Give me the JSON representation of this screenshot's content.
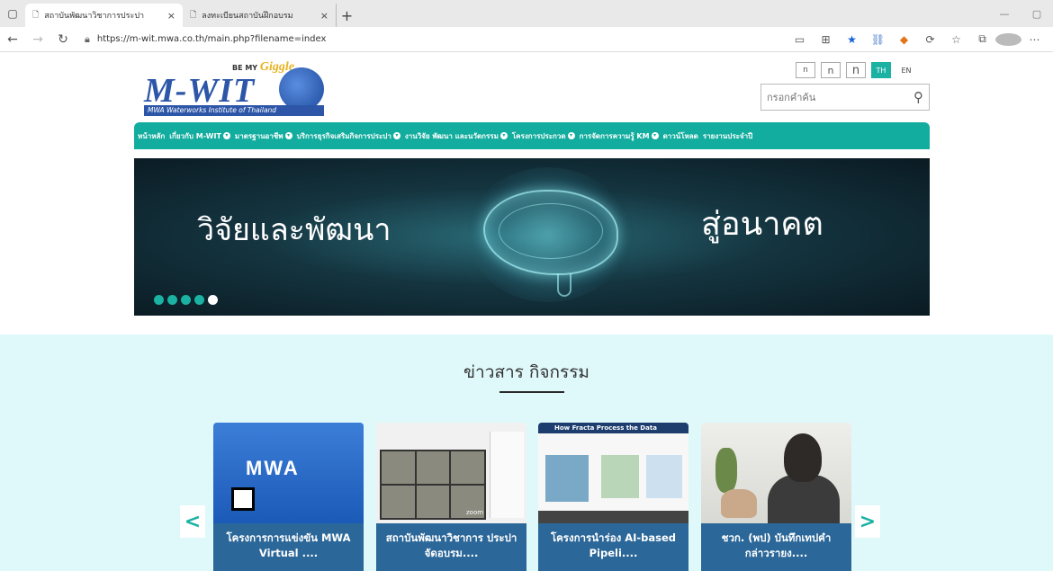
{
  "browser": {
    "tabs": [
      {
        "title": "สถาบันพัฒนาวิชาการประปา"
      },
      {
        "title": "ลงทะเบียนสถาบันฝึกอบรม"
      }
    ],
    "tab_close": "×",
    "new_tab": "+",
    "url": "https://m-wit.mwa.co.th/main.php?filename=index",
    "icons": [
      "back-icon",
      "forward-icon",
      "refresh-icon",
      "lock-icon",
      "reading-view-icon",
      "qr-icon",
      "favorite-star-icon",
      "link-icon",
      "metamask-fox-icon",
      "extension-icon",
      "favorites-icon",
      "collections-icon",
      "profile-icon",
      "more-icon"
    ]
  },
  "header": {
    "logo_tag_prefix": "BE MY",
    "logo_tag_brand": "Giggle",
    "logo_main": "M-WIT",
    "logo_sub": "MWA Waterworks Institute of Thailand",
    "font_size_small": "n",
    "font_size_medium": "n",
    "font_size_large": "n",
    "lang_th": "TH",
    "lang_en": "EN",
    "search_placeholder": "กรอกคำค้น",
    "colors": {
      "accent": "#12ad9e",
      "brand_blue": "#2d56a8",
      "caption_blue": "#2b6798"
    }
  },
  "menu": [
    {
      "label": "หน้าหลัก",
      "dropdown": false
    },
    {
      "label": "เกี่ยวกับ M-WIT",
      "dropdown": true
    },
    {
      "label": "มาตรฐานอาชีพ",
      "dropdown": true
    },
    {
      "label": "บริการธุรกิจเสริมกิจการประปา",
      "dropdown": true
    },
    {
      "label": "งานวิจัย พัฒนา และนวัตกรรม",
      "dropdown": true
    },
    {
      "label": "โครงการประกวด",
      "dropdown": true
    },
    {
      "label": "การจัดการความรู้ KM",
      "dropdown": true
    },
    {
      "label": "ดาวน์โหลด",
      "dropdown": false
    },
    {
      "label": "รายงานประจำปี",
      "dropdown": false
    }
  ],
  "hero": {
    "text_left": "วิจัยและพัฒนา",
    "text_right": "สู่อนาคต",
    "slide_count": 5,
    "active_slide": 5
  },
  "news": {
    "title": "ข่าวสาร กิจกรรม",
    "prev": "<",
    "next": ">",
    "cards": [
      {
        "caption": "โครงการการแข่งขัน MWA Virtual ....",
        "thumb_text": "MWA"
      },
      {
        "caption": "สถาบันพัฒนาวิชาการ ประปาจัดอบรม....",
        "thumb_text": "zoom"
      },
      {
        "caption": "โครงการนำร่อง AI-based Pipeli....",
        "thumb_text": "How Fracta Process the Data"
      },
      {
        "caption": "ชวก. (พป) บันทึกเทปคำ กล่าวรายง....",
        "thumb_text": ""
      }
    ]
  }
}
